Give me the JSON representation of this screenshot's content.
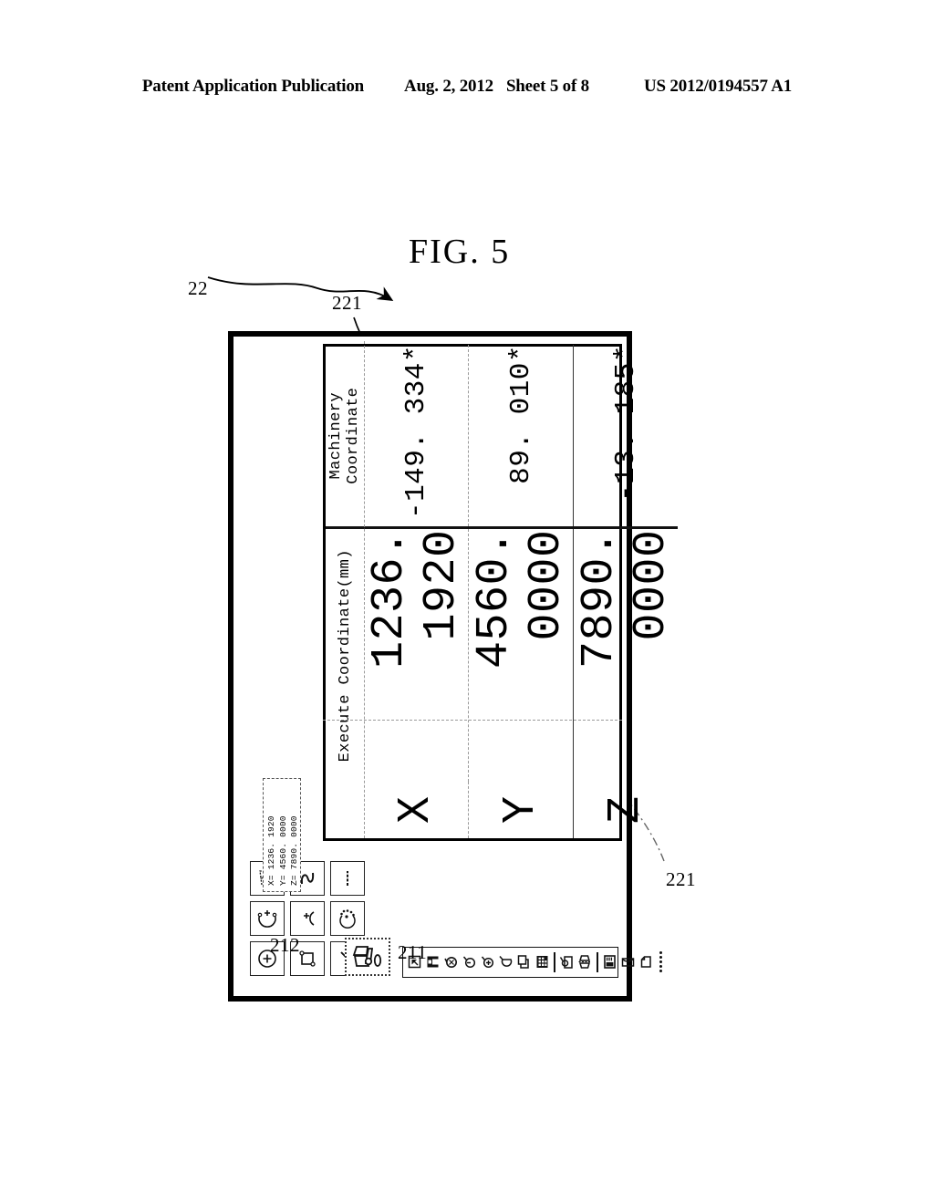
{
  "header": {
    "publication": "Patent Application Publication",
    "date": "Aug. 2, 2012",
    "sheet": "Sheet 5 of 8",
    "number": "US 2012/0194557 A1"
  },
  "figure": {
    "label": "FIG. 5",
    "references": {
      "device": "22",
      "toolbar": "211",
      "mini_readout": "212",
      "row_divider_upper": "221",
      "row_divider_lower": "221"
    }
  },
  "mini_readout": {
    "line_x": "X= 1236. 1920",
    "line_y": "Y= 4560. 0000",
    "line_z": "Z= 7890. 0000"
  },
  "icon_palette": {
    "icons": [
      {
        "name": "circle-plus-icon"
      },
      {
        "name": "arc-plus-icon"
      },
      {
        "name": "grid-tiles-icon"
      },
      {
        "name": "rectangle-path-icon"
      },
      {
        "name": "arc-center-plus-icon"
      },
      {
        "name": "spline-curve-icon"
      },
      {
        "name": "line-icon"
      },
      {
        "name": "point-array-arc-icon"
      },
      {
        "name": "dashed-line-icon"
      }
    ]
  },
  "vertical_toolbar": {
    "icons": [
      {
        "name": "file-open-icon"
      },
      {
        "name": "save-icon"
      },
      {
        "name": "circle-edit-icon"
      },
      {
        "name": "circle-radius-icon"
      },
      {
        "name": "circle-center-icon"
      },
      {
        "name": "arc-segment-icon"
      },
      {
        "name": "copy-icon"
      },
      {
        "name": "grid-pattern-icon"
      },
      {
        "name": "separator-1"
      },
      {
        "name": "rotate-object-icon"
      },
      {
        "name": "mirror-object-icon"
      },
      {
        "name": "separator-2"
      },
      {
        "name": "layout-view-icon"
      },
      {
        "name": "fold-page-icon"
      },
      {
        "name": "page-icon"
      },
      {
        "name": "dot-row-icon"
      }
    ]
  },
  "tool_button": {
    "name": "workpiece-tool-icon"
  },
  "coordinate_panel": {
    "columns": [
      {
        "key": "axis",
        "label": ""
      },
      {
        "key": "execute",
        "label": "Execute Coordinate(mm)"
      },
      {
        "key": "machinery",
        "label": "Machinery Coordinate"
      }
    ],
    "rows": [
      {
        "axis": "X",
        "execute": "1236. 1920",
        "machinery": "-149. 334*"
      },
      {
        "axis": "Y",
        "execute": "4560. 0000",
        "machinery": "89. 010*"
      },
      {
        "axis": "Z",
        "execute": "7890. 0000",
        "machinery": "-13. 185*"
      }
    ]
  }
}
